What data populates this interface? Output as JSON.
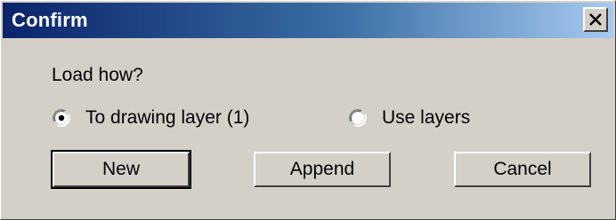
{
  "dialog": {
    "title": "Confirm",
    "close_label": "close",
    "prompt": "Load how?",
    "options": [
      {
        "label": "To drawing layer (1)",
        "selected": true
      },
      {
        "label": "Use layers",
        "selected": false
      }
    ],
    "buttons": {
      "new": "New",
      "append": "Append",
      "cancel": "Cancel"
    }
  },
  "colors": {
    "titlebar_start": "#0a246a",
    "titlebar_end": "#a6caf0",
    "face": "#d4d0c8"
  },
  "icons": {
    "close": "close-icon",
    "radio_selected": "radio-selected-icon",
    "radio_unselected": "radio-unselected-icon"
  }
}
